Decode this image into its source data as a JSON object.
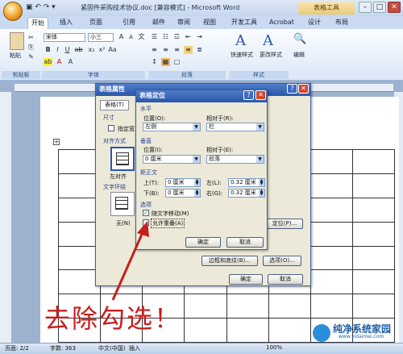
{
  "window": {
    "title": "紧固件采购技术协议.doc [兼容模式] - Microsoft Word",
    "context_tab_title": "表格工具",
    "qat": "▣ ↶ ↷ ▾"
  },
  "ribbon_tabs": [
    "开始",
    "插入",
    "页面",
    "引用",
    "邮件",
    "审阅",
    "视图",
    "开发工具",
    "Acrobat",
    "设计",
    "布局"
  ],
  "ribbon": {
    "clipboard": {
      "paste_label": "粘贴",
      "group_label": "剪贴板"
    },
    "font": {
      "name": "宋体",
      "size": "小三",
      "group_label": "字体"
    },
    "paragraph": {
      "group_label": "段落"
    },
    "styles": {
      "quick_styles": "快速样式",
      "change_styles": "更改样式",
      "group_label": "样式"
    },
    "editing": {
      "label": "编辑"
    }
  },
  "table_properties_dialog": {
    "title": "表格属性",
    "tab_table": "表格(T)",
    "size_label": "尺寸",
    "preferred_width": "指定宽",
    "alignment_label": "对齐方式",
    "align_left": "左对齐",
    "text_wrap_label": "文字环绕",
    "wrap_none": "无(N)",
    "positioning_button": "定位(P)...",
    "borders_button": "边框和底纹(B)...",
    "options_button": "选项(O)...",
    "ok": "确定",
    "cancel": "取消"
  },
  "table_positioning_dialog": {
    "title": "表格定位",
    "horizontal": {
      "label": "水平",
      "position_label": "位置(O):",
      "position_value": "左侧",
      "relative_label": "相对于(R):",
      "relative_value": "栏"
    },
    "vertical": {
      "label": "垂直",
      "position_label": "位置(I):",
      "position_value": "0 厘米",
      "relative_label": "相对于(E):",
      "relative_value": "段落"
    },
    "distance": {
      "label": "距正文",
      "top_label": "上(T):",
      "top_value": "0 厘米",
      "left_label": "左(L):",
      "left_value": "0.32 厘米",
      "bottom_label": "下(B):",
      "bottom_value": "0 厘米",
      "right_label": "右(G):",
      "right_value": "0.32 厘米"
    },
    "options": {
      "label": "选项",
      "move_with_text": "随文字移动(M)",
      "move_with_text_checked": true,
      "allow_overlap": "允许重叠(A)",
      "allow_overlap_checked": false
    },
    "ok": "确定",
    "cancel": "取消"
  },
  "annotation": "去除勾选！",
  "statusbar": {
    "page": "页面: 2/2",
    "words": "字数: 363",
    "lang": "中文(中国)",
    "mode": "插入",
    "zoom": "100%"
  },
  "watermark": {
    "site": "纯净系统家园",
    "url": "www.yidaimei.com"
  },
  "colors": {
    "arrow": "#c81e1e",
    "dialog_title": "#2b56a8"
  }
}
